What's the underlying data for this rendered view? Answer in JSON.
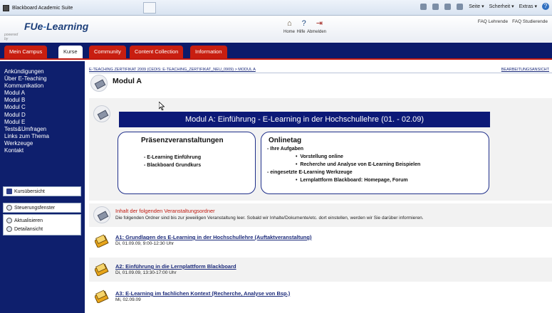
{
  "browser": {
    "tab_title": "Blackboard Academic Suite",
    "toolbar": [
      "Seite",
      "Scherheit",
      "Extras"
    ]
  },
  "header": {
    "powered_by": "powered by",
    "logo_prefix": "FUe",
    "logo_suffix": "Learning",
    "icons": [
      {
        "name": "home-icon",
        "label": "Home",
        "glyph": "⌂"
      },
      {
        "name": "help-icon",
        "label": "Hilfe",
        "glyph": "?"
      },
      {
        "name": "logout-icon",
        "label": "Abmelden",
        "glyph": "⇥"
      }
    ],
    "faq_links": [
      "FAQ Lehrende",
      "FAQ Studierende"
    ]
  },
  "nav": {
    "tabs": [
      "Mein Campus",
      "Kurse",
      "Community",
      "Content Collection",
      "Information"
    ],
    "active": "Kurse"
  },
  "sidebar": {
    "items": [
      "Ankündigungen",
      "Über E-Teaching",
      "Kommunikation",
      "Modul A",
      "Modul B",
      "Modul C",
      "Modul D",
      "Modul E",
      "Tests&Umfragen",
      "Links zum Thema",
      "Werkzeuge",
      "Kontakt"
    ],
    "course_overview": "Kursübersicht",
    "control_panel": "Steuerungsfenster",
    "refresh": "Aktualisieren",
    "detail_view": "Detailansicht"
  },
  "main": {
    "breadcrumb": "E-TEACHING ZERTIFIKAT 2009 (CEDIS: E-TEACHING_ZERTIFIKAT_NEU_0909) > MODUL A",
    "edit_view": "BEARBEITUNGSANSICHT",
    "page_title": "Modul A",
    "banner": "Modul A: Einführung - E-Learning in der Hochschullehre (01. - 02.09)",
    "left_card": {
      "title": "Präsenzveranstaltungen",
      "lines": [
        "- E-Learning Einführung",
        "- Blackboard Grundkurs"
      ]
    },
    "right_card": {
      "title": "Onlinetag",
      "task_header": "- Ihre Aufgaben",
      "tasks": [
        "Vorstellung online",
        "Recherche und Analyse von E-Learning Beispielen"
      ],
      "tools_header": "- eingesetzte E-Learning Werkzeuge",
      "tools": [
        "Lernplattform Blackboard: Homepage, Forum"
      ]
    },
    "notice": {
      "title": "Inhalt der folgenden Veranstaltungsordner",
      "text": "Die folgenden Ordner sind bis zur jeweiligen Veranstaltung leer. Sobald wir Inhalte/Dokumente/etc. dort einstellen, werden wir Sie darüber informieren."
    },
    "items": [
      {
        "title": "A1: Grundlagen des E-Learning in der Hochschullehre (Auftaktveranstaltung)",
        "sub": "Di, 01.09.09, 9:00-12:30 Uhr"
      },
      {
        "title": "A2: Einführung in die Lernplattform Blackboard",
        "sub": "Di, 01.09.09, 13:30-17:00 Uhr"
      },
      {
        "title": "A3: E-Learning im fachlichen Kontext (Recherche, Analyse von Bsp.)",
        "sub": "Mi, 02.09.09"
      }
    ]
  },
  "colors": {
    "navy": "#0e1f6d",
    "red": "#c81e10",
    "link": "#1b2a7a"
  }
}
